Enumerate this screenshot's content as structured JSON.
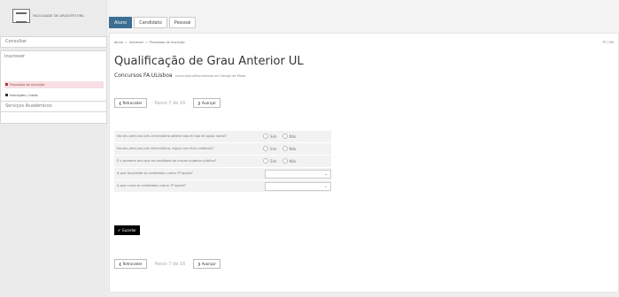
{
  "header": {
    "logo_text": "FACULDADE DE ARQUITETURA",
    "tabs": [
      "Aluno",
      "Candidato",
      "Pessoal"
    ]
  },
  "sidebar": {
    "consultar": "Consultar",
    "inscrever": "Inscrever",
    "sub_items": [
      "Processos de inscrição",
      "Instruções / Listas"
    ],
    "servicos": "Serviços Académicos"
  },
  "breadcrumb": [
    "Aluno",
    "Inscrever",
    "Processos de Inscrição"
  ],
  "lang": "PT / EN",
  "page": {
    "title": "Qualificação de Grau Anterior UL",
    "subtitle": "Concursos FA.ULisboa",
    "subtitle_small": "Licenciatura/Bacharelato em Design de Moda"
  },
  "nav": {
    "prev": "Retroceder",
    "step": "Passo 7 de 16",
    "next": "Avançar"
  },
  "form": {
    "questions": [
      "No seu percurso pré-universitário obteve algum tipo de apoio social?",
      "No seu percurso pré-universitário, algum vez ficou retido(a)?",
      "É o primeiro ano que se candidata ao ensino superior público?",
      "A que faculdade se candidatou como 1ª opção?",
      "A que curso se candidatou como 1ª opção?"
    ],
    "yes": "Sim",
    "no": "Não",
    "save": "Guardar"
  }
}
